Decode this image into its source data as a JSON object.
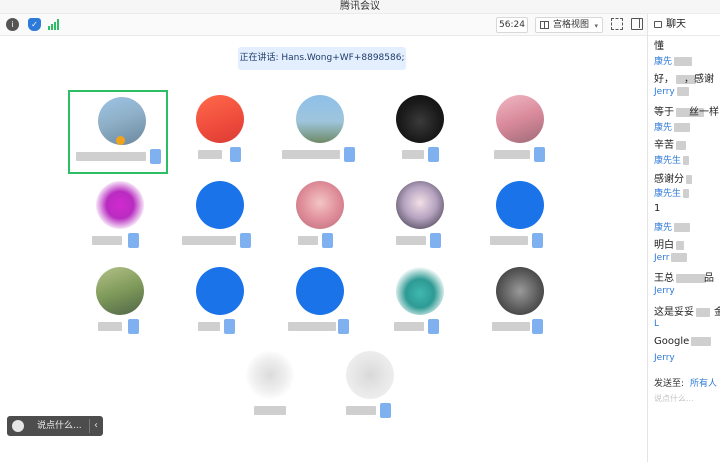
{
  "window": {
    "title": "腾讯会议"
  },
  "toolbar": {
    "info_icon": "info-icon",
    "shield_icon": "shield-icon",
    "signal_icon": "signal-icon",
    "timer": "56:24",
    "view_label": "宫格视图",
    "caret": "▾"
  },
  "speaker": {
    "text": "正在讲话: Hans.Wong+WF+8898586;"
  },
  "chat": {
    "title": "聊天",
    "lines": [
      {
        "kind": "msg",
        "text": "懂"
      },
      {
        "kind": "name",
        "text": "康先"
      },
      {
        "kind": "msg",
        "text": "好，"
      },
      {
        "kind": "msg",
        "text": "，感谢"
      },
      {
        "kind": "name",
        "text": "Jerry"
      },
      {
        "kind": "msg",
        "text": "等于"
      },
      {
        "kind": "msg",
        "text": "丝一样"
      },
      {
        "kind": "name",
        "text": "康先"
      },
      {
        "kind": "msg",
        "text": "辛苦"
      },
      {
        "kind": "name",
        "text": "康先生"
      },
      {
        "kind": "msg",
        "text": "感谢分"
      },
      {
        "kind": "name",
        "text": "康先生"
      },
      {
        "kind": "msg",
        "text": "1"
      },
      {
        "kind": "name",
        "text": "康先"
      },
      {
        "kind": "msg",
        "text": "明白"
      },
      {
        "kind": "name",
        "text": "Jerr"
      },
      {
        "kind": "msg",
        "text": "王总"
      },
      {
        "kind": "msg",
        "text": "品"
      },
      {
        "kind": "name",
        "text": "Jerry"
      },
      {
        "kind": "msg",
        "text": "这是妥妥"
      },
      {
        "kind": "msg",
        "text": "金"
      },
      {
        "kind": "name",
        "text": "L"
      },
      {
        "kind": "msg",
        "text": "Google"
      },
      {
        "kind": "name",
        "text": "Jerry"
      }
    ],
    "send_to_label": "发送至:",
    "send_to_target": "所有人",
    "input_placeholder": "说点什么..."
  },
  "say_bar": {
    "placeholder": "说点什么...",
    "chevron": "‹"
  },
  "colors": {
    "accent_green": "#2dbd64",
    "accent_blue": "#1a73e8",
    "speaker_bg": "#e3efff"
  }
}
